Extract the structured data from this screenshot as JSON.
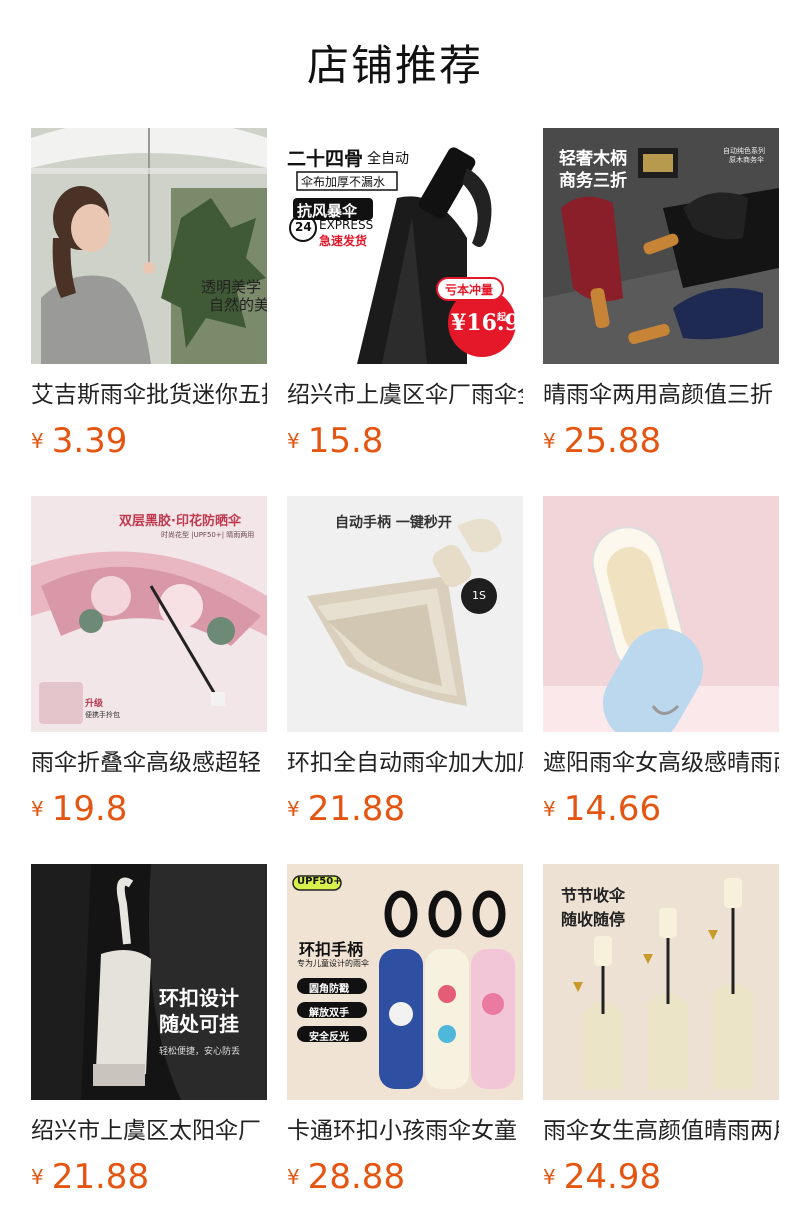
{
  "page": {
    "title": "店铺推荐"
  },
  "products": [
    {
      "name": "艾吉斯雨伞批货迷你五折伞",
      "currency": "¥",
      "price": "3.39",
      "image_text": [
        "透明美学",
        "自然的美"
      ]
    },
    {
      "name": "绍兴市上虞区伞厂雨伞全自动",
      "currency": "¥",
      "price": "15.8",
      "image_text": [
        "二十四骨",
        "全自动",
        "伞布加厚不漏水",
        "抗风暴伞",
        "24",
        "EXPRESS",
        "急速发货",
        "亏本冲量",
        "¥16.9",
        "起"
      ]
    },
    {
      "name": "晴雨伞两用高颜值三折",
      "currency": "¥",
      "price": "25.88",
      "image_text": [
        "轻奢木柄",
        "商务三折",
        "自动纯色系列",
        "原木商务伞"
      ]
    },
    {
      "name": "雨伞折叠伞高级感超轻",
      "currency": "¥",
      "price": "19.8",
      "image_text": [
        "双层黑胶·印花防晒伞",
        "时尚花型 |UPF50+| 晴雨两用",
        "升级",
        "便携手拎包"
      ]
    },
    {
      "name": "环扣全自动雨伞加大加厚",
      "currency": "¥",
      "price": "21.88",
      "image_text": [
        "自动手柄 一键秒开",
        "1S"
      ]
    },
    {
      "name": "遮阳雨伞女高级感晴雨两用",
      "currency": "¥",
      "price": "14.66",
      "image_text": []
    },
    {
      "name": "绍兴市上虞区太阳伞厂",
      "currency": "¥",
      "price": "21.88",
      "image_text": [
        "环扣设计",
        "随处可挂",
        "轻松便捷，安心防丢"
      ]
    },
    {
      "name": "卡通环扣小孩雨伞女童",
      "currency": "¥",
      "price": "28.88",
      "image_text": [
        "UPF50+",
        "环扣手柄",
        "专为儿童设计的雨伞",
        "圆角防戳",
        "解放双手",
        "安全反光"
      ]
    },
    {
      "name": "雨伞女生高颜值晴雨两用",
      "currency": "¥",
      "price": "24.98",
      "image_text": [
        "节节收伞",
        "随收随停"
      ]
    }
  ],
  "colors": {
    "price": "#e55512",
    "text": "#222222"
  }
}
